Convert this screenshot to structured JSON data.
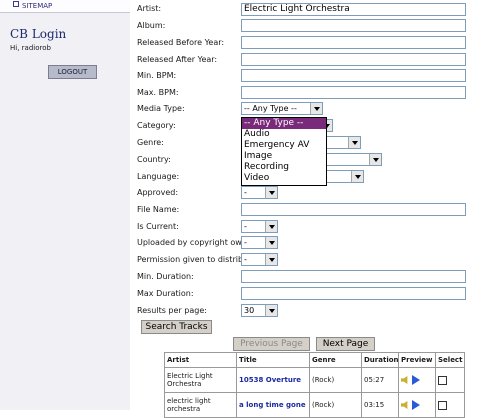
{
  "sidebar": {
    "sitemap_label": "SITEMAP",
    "title": "CB Login",
    "greeting": "Hi, radiorob",
    "logout_label": "LOGOUT"
  },
  "form": {
    "artist": {
      "label": "Artist:",
      "value": "Electric Light Orchestra"
    },
    "album": {
      "label": "Album:",
      "value": ""
    },
    "released_before": {
      "label": "Released Before Year:",
      "value": ""
    },
    "released_after": {
      "label": "Released After Year:",
      "value": ""
    },
    "min_bpm": {
      "label": "Min. BPM:",
      "value": ""
    },
    "max_bpm": {
      "label": "Max. BPM:",
      "value": ""
    },
    "media_type": {
      "label": "Media Type:",
      "value": "-- Any Type --",
      "options": [
        "-- Any Type --",
        "Audio",
        "Emergency AV",
        "Image",
        "Recording",
        "Video"
      ],
      "highlighted": "-- Any Type --"
    },
    "category": {
      "label": "Category:"
    },
    "genre": {
      "label": "Genre:"
    },
    "country": {
      "label": "Country:"
    },
    "language": {
      "label": "Language:"
    },
    "approved": {
      "label": "Approved:",
      "value": "-"
    },
    "file_name": {
      "label": "File Name:",
      "value": ""
    },
    "is_current": {
      "label": "Is Current:",
      "value": "-"
    },
    "uploaded_by_owner": {
      "label": "Uploaded by copyright owner:",
      "value": "-"
    },
    "permission": {
      "label": "Permission given to distribute:",
      "value": "-"
    },
    "min_duration": {
      "label": "Min. Duration:",
      "value": ""
    },
    "max_duration": {
      "label": "Max Duration:",
      "value": ""
    },
    "results_per_page": {
      "label": "Results per page:",
      "value": "30"
    },
    "search_button": "Search Tracks"
  },
  "pagination": {
    "previous_label": "Previous Page",
    "next_label": "Next Page"
  },
  "results": {
    "headers": [
      "Artist",
      "Title",
      "Genre",
      "Duration",
      "Preview",
      "Select"
    ],
    "rows": [
      {
        "artist": "Electric Light Orchestra",
        "title": "10538 Overture",
        "genre": "(Rock)",
        "duration": "05:27"
      },
      {
        "artist": "electric light orchestra",
        "title": "a long time gone",
        "genre": "(Rock)",
        "duration": "03:15"
      }
    ]
  },
  "icons": {
    "preview": "speaker-icon",
    "play": "play-icon"
  },
  "colors": {
    "highlight": "#7a2a7a",
    "link": "#1b2aa0",
    "sidebar_bg": "#f0f0f5"
  }
}
